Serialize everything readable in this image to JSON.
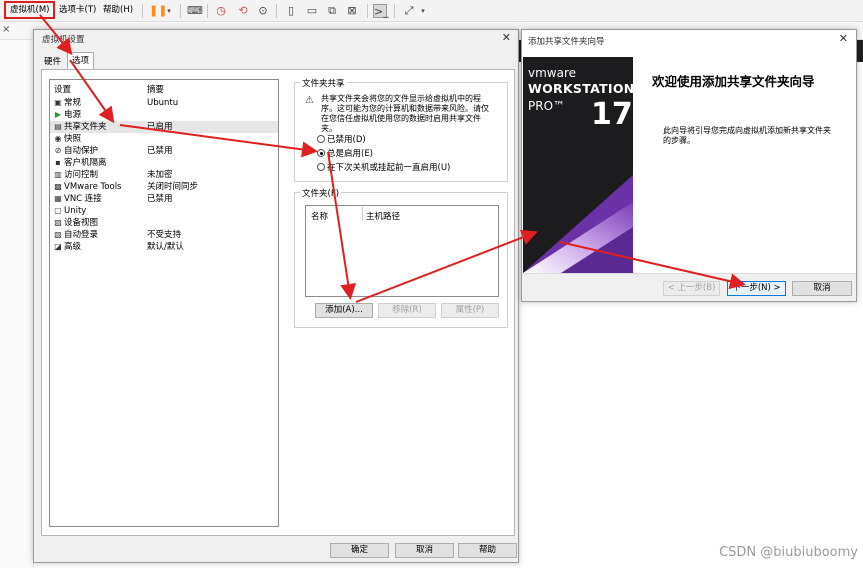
{
  "menubar": {
    "vm_menu": "虚拟机(M)",
    "tabs_menu": "选项卡(T)",
    "help_menu": "帮助(H)"
  },
  "settings_dialog": {
    "title": "虚拟机设置",
    "tabs": {
      "hardware": "硬件",
      "options": "选项"
    },
    "list_header": {
      "setting": "设置",
      "summary": "摘要"
    },
    "items": [
      {
        "name": "常规",
        "summary": "Ubuntu",
        "icon": "general-icon"
      },
      {
        "name": "电源",
        "summary": "",
        "icon": "power-icon"
      },
      {
        "name": "共享文件夹",
        "summary": "已启用",
        "icon": "shared-folder-icon"
      },
      {
        "name": "快照",
        "summary": "",
        "icon": "snapshot-icon"
      },
      {
        "name": "自动保护",
        "summary": "已禁用",
        "icon": "autoprotect-icon"
      },
      {
        "name": "客户机隔离",
        "summary": "",
        "icon": "isolation-icon"
      },
      {
        "name": "访问控制",
        "summary": "未加密",
        "icon": "access-control-icon"
      },
      {
        "name": "VMware Tools",
        "summary": "关闭时间同步",
        "icon": "vmware-tools-icon"
      },
      {
        "name": "VNC 连接",
        "summary": "已禁用",
        "icon": "vnc-icon"
      },
      {
        "name": "Unity",
        "summary": "",
        "icon": "unity-icon"
      },
      {
        "name": "设备视图",
        "summary": "",
        "icon": "device-view-icon"
      },
      {
        "name": "自动登录",
        "summary": "不受支持",
        "icon": "autologin-icon"
      },
      {
        "name": "高级",
        "summary": "默认/默认",
        "icon": "advanced-icon"
      }
    ],
    "sharing_group": {
      "title": "文件夹共享",
      "description": "共享文件夹会将您的文件显示给虚拟机中的程序。这可能为您的计算机和数据带来风险。请仅在您信任虚拟机使用您的数据时启用共享文件夹。",
      "options": [
        "已禁用(D)",
        "总是启用(E)",
        "在下次关机或挂起前一直启用(U)"
      ],
      "selected_index": 1
    },
    "folders_group": {
      "title": "文件夹(F)",
      "col_name": "名称",
      "col_host_path": "主机路径",
      "add": "添加(A)...",
      "remove": "移除(R)",
      "properties": "属性(P)"
    },
    "ok": "确定",
    "cancel": "取消",
    "help": "帮助"
  },
  "wizard": {
    "title": "添加共享文件夹向导",
    "brand": "vmware",
    "product": "WORKSTATION",
    "edition": "PRO™",
    "version": "17",
    "heading": "欢迎使用添加共享文件夹向导",
    "text": "此向导将引导您完成向虚拟机添加新共享文件夹的步骤。",
    "back": "< 上一步(B)",
    "next": "下一步(N) >",
    "cancel": "取消"
  },
  "watermark": "CSDN @biubiuboomy",
  "colors": {
    "annotation": "#e02020",
    "accent": "#0078d7",
    "banner_purple": "#7b3fb8"
  }
}
